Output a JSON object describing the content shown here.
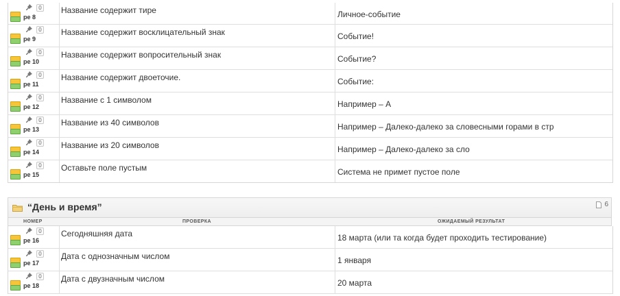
{
  "top_rows": [
    {
      "id": "pe 8",
      "badge": "0",
      "check": "Название содержит тире",
      "result": "Личное-событие"
    },
    {
      "id": "pe 9",
      "badge": "0",
      "check": "Название содержит восклицательный знак",
      "result": "Событие!"
    },
    {
      "id": "pe 10",
      "badge": "0",
      "check": "Название содержит вопросительный знак",
      "result": "Событие?"
    },
    {
      "id": "pe 11",
      "badge": "0",
      "check": "Название содержит двоеточие.",
      "result": "Событие:"
    },
    {
      "id": "pe 12",
      "badge": "0",
      "check": "Название с 1 символом",
      "result": "Например – А"
    },
    {
      "id": "pe 13",
      "badge": "0",
      "check": "Название из 40 символов",
      "result": "Например – Далеко-далеко за словесными горами в стр"
    },
    {
      "id": "pe 14",
      "badge": "0",
      "check": "Название из 20 символов",
      "result": "Например – Далеко-далеко за сло"
    },
    {
      "id": "pe 15",
      "badge": "0",
      "check": "Оставьте поле пустым",
      "result": "Система не примет пустое поле"
    }
  ],
  "section": {
    "title": "“День и время”",
    "count": "6",
    "columns": {
      "number": "НОМЕР",
      "check": "ПРОВЕРКА",
      "expected": "ОЖИДАЕМЫЙ РЕЗУЛЬТАТ"
    },
    "rows": [
      {
        "id": "pe 16",
        "badge": "0",
        "check": "Сегодняшняя дата",
        "result": "18 марта (или та когда будет проходить тестирование)"
      },
      {
        "id": "pe 17",
        "badge": "0",
        "check": "Дата с однозначным числом",
        "result": "1 января"
      },
      {
        "id": "pe 18",
        "badge": "0",
        "check": "Дата с двузначным числом",
        "result": "20 марта"
      }
    ]
  },
  "colors": {
    "priority_yellow": "#f6c53a",
    "status_green": "#8fcf6e",
    "border": "#dedede"
  }
}
